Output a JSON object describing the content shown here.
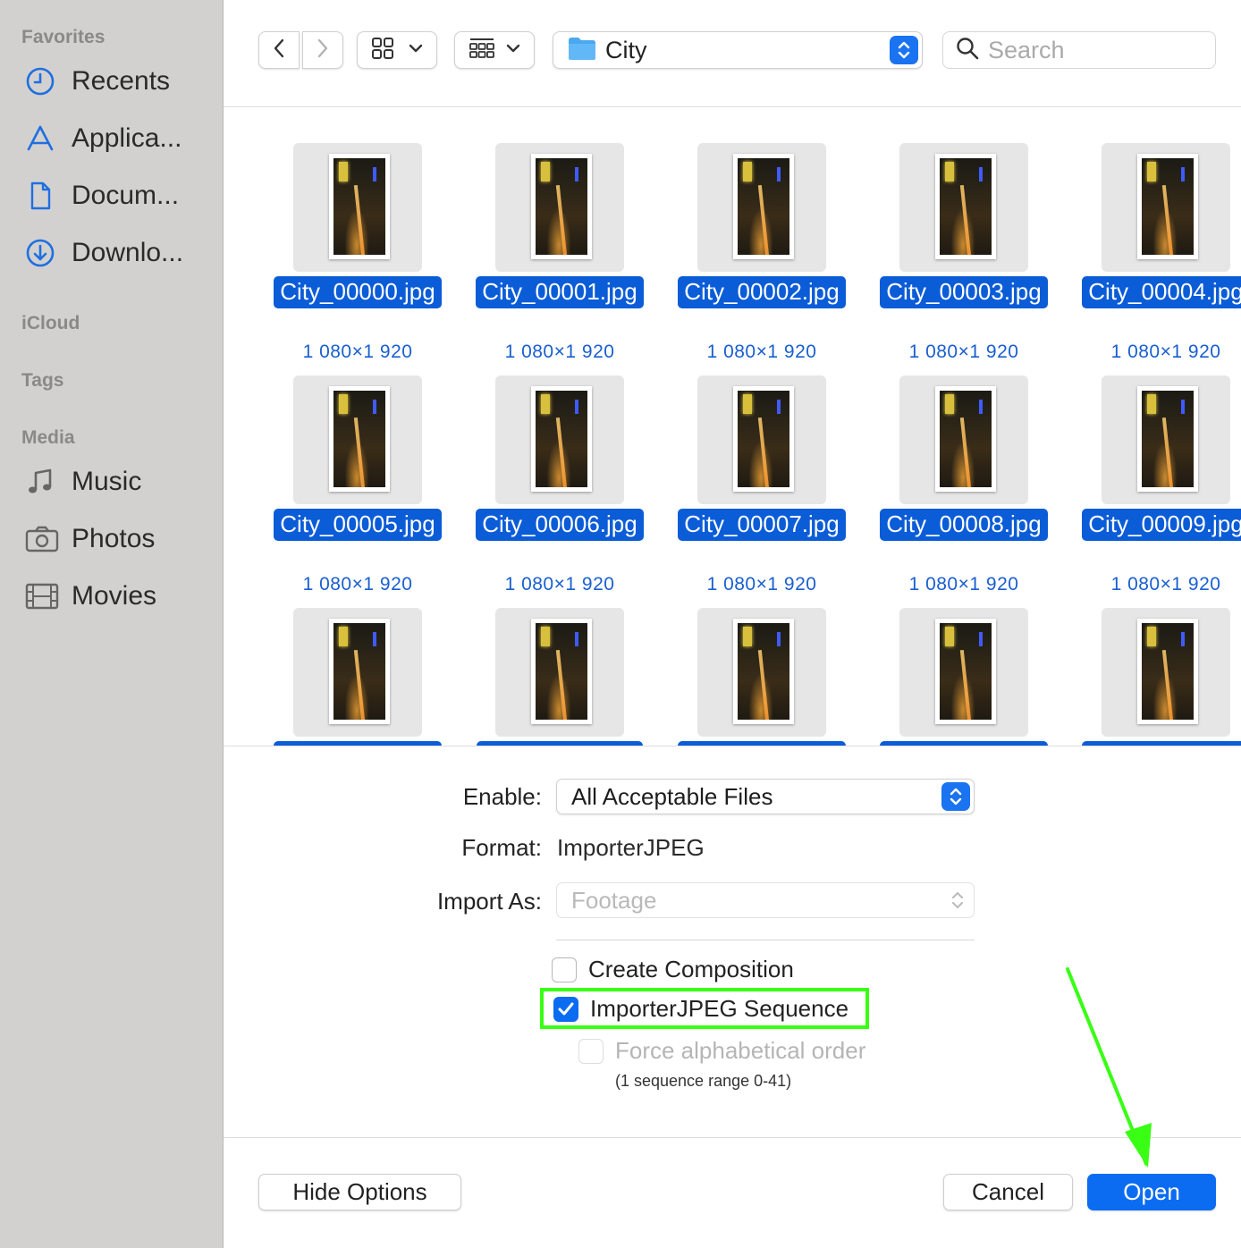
{
  "sidebar": {
    "favorites_title": "Favorites",
    "favorites": [
      {
        "label": "Recents",
        "icon": "clock-icon"
      },
      {
        "label": "Applica...",
        "icon": "applications-icon"
      },
      {
        "label": "Docum...",
        "icon": "document-icon"
      },
      {
        "label": "Downlo...",
        "icon": "download-icon"
      }
    ],
    "icloud_title": "iCloud",
    "tags_title": "Tags",
    "media_title": "Media",
    "media": [
      {
        "label": "Music",
        "icon": "music-note-icon"
      },
      {
        "label": "Photos",
        "icon": "camera-icon"
      },
      {
        "label": "Movies",
        "icon": "film-icon"
      }
    ]
  },
  "toolbar": {
    "folder_name": "City",
    "search_placeholder": "Search"
  },
  "files": [
    {
      "name": "City_00000.jpg",
      "dims": "1 080×1 920"
    },
    {
      "name": "City_00001.jpg",
      "dims": "1 080×1 920"
    },
    {
      "name": "City_00002.jpg",
      "dims": "1 080×1 920"
    },
    {
      "name": "City_00003.jpg",
      "dims": "1 080×1 920"
    },
    {
      "name": "City_00004.jpg",
      "dims": "1 080×1 920"
    },
    {
      "name": "City_00005.jpg",
      "dims": "1 080×1 920"
    },
    {
      "name": "City_00006.jpg",
      "dims": "1 080×1 920"
    },
    {
      "name": "City_00007.jpg",
      "dims": "1 080×1 920"
    },
    {
      "name": "City_00008.jpg",
      "dims": "1 080×1 920"
    },
    {
      "name": "City_00009.jpg",
      "dims": "1 080×1 920"
    }
  ],
  "options": {
    "enable_label": "Enable:",
    "enable_value": "All Acceptable Files",
    "format_label": "Format:",
    "format_value": "ImporterJPEG",
    "import_as_label": "Import As:",
    "import_as_value": "Footage",
    "create_composition": {
      "label": "Create Composition",
      "checked": false
    },
    "sequence": {
      "label": "ImporterJPEG Sequence",
      "checked": true
    },
    "force_alpha": {
      "label": "Force alphabetical order",
      "checked": false
    },
    "sequence_note": "(1 sequence range 0-41)"
  },
  "buttons": {
    "hide_options": "Hide Options",
    "cancel": "Cancel",
    "open": "Open"
  },
  "colors": {
    "accent": "#0b6cf2",
    "selection": "#0b5cd7",
    "highlight": "#39ff14"
  }
}
